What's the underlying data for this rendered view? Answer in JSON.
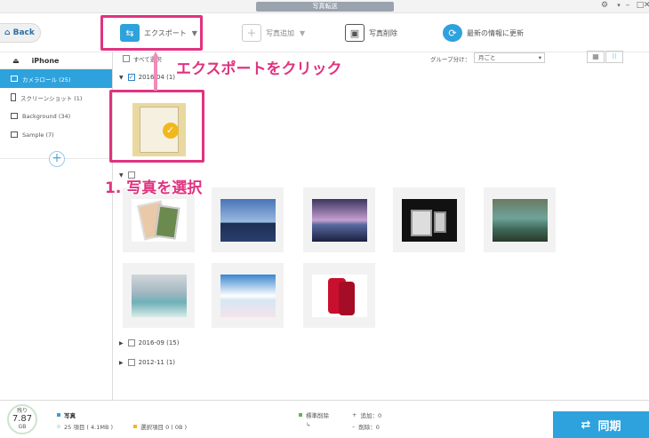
{
  "window": {
    "title": "写真転送"
  },
  "toolbar": {
    "back_label": "Back",
    "export_label": "エクスポート",
    "add_label": "写真追加",
    "delete_label": "写真削除",
    "refresh_label": "最新の情報に更新"
  },
  "subbar": {
    "select_all_label": "すべて選択",
    "group_by_label": "グループ分け：",
    "group_by_value": "月ごと"
  },
  "sidebar": {
    "device_name": "iPhone",
    "items": [
      {
        "label": "カメラロール (25)"
      },
      {
        "label": "スクリーンショット (1)"
      },
      {
        "label": "Background (34)"
      },
      {
        "label": "Sample (7)"
      }
    ]
  },
  "groups": [
    {
      "label": "2016-04 (1)"
    },
    {
      "label": "2016-09 (15)"
    },
    {
      "label": "2012-11 (1)"
    }
  ],
  "annotations": {
    "export_hint": "エクスポートをクリック",
    "select_hint": "1. 写真を選択"
  },
  "status": {
    "disk_label": "残り",
    "disk_value": "7.87",
    "disk_unit": "GB",
    "category": "写真",
    "items_info": "25 項目 ( 4.1MB )",
    "selected_info": "選択項目 0 ( 0B )",
    "sync_flag_label": "標準削除",
    "add_count": "追加：0",
    "delete_count": "削除：0",
    "sync_button": "同期"
  },
  "colors": {
    "accent": "#2ea2dc",
    "highlight": "#e0337f"
  }
}
